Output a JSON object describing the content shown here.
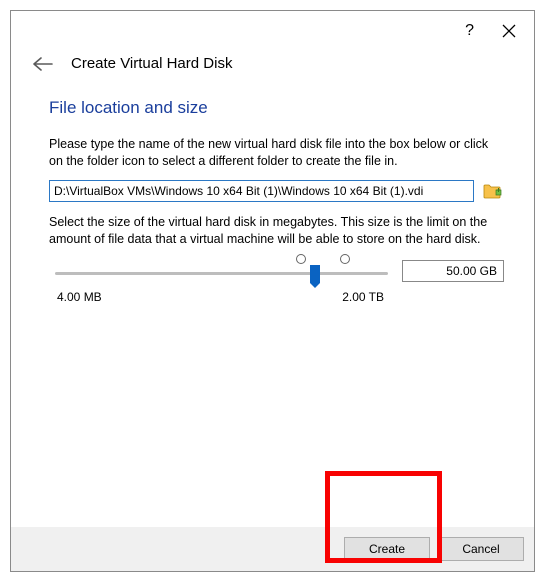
{
  "header": {
    "title": "Create Virtual Hard Disk"
  },
  "section": {
    "title": "File location and size"
  },
  "instructions": {
    "file_location": "Please type the name of the new virtual hard disk file into the box below or click on the folder icon to select a different folder to create the file in.",
    "file_size": "Select the size of the virtual hard disk in megabytes. This size is the limit on the amount of file data that a virtual machine will be able to store on the hard disk."
  },
  "file_path": {
    "value": "D:\\VirtualBox VMs\\Windows 10 x64 Bit (1)\\Windows 10 x64 Bit (1).vdi"
  },
  "slider": {
    "min_label": "4.00 MB",
    "max_label": "2.00 TB",
    "size_value": "50.00 GB"
  },
  "buttons": {
    "create": "Create",
    "cancel": "Cancel"
  }
}
